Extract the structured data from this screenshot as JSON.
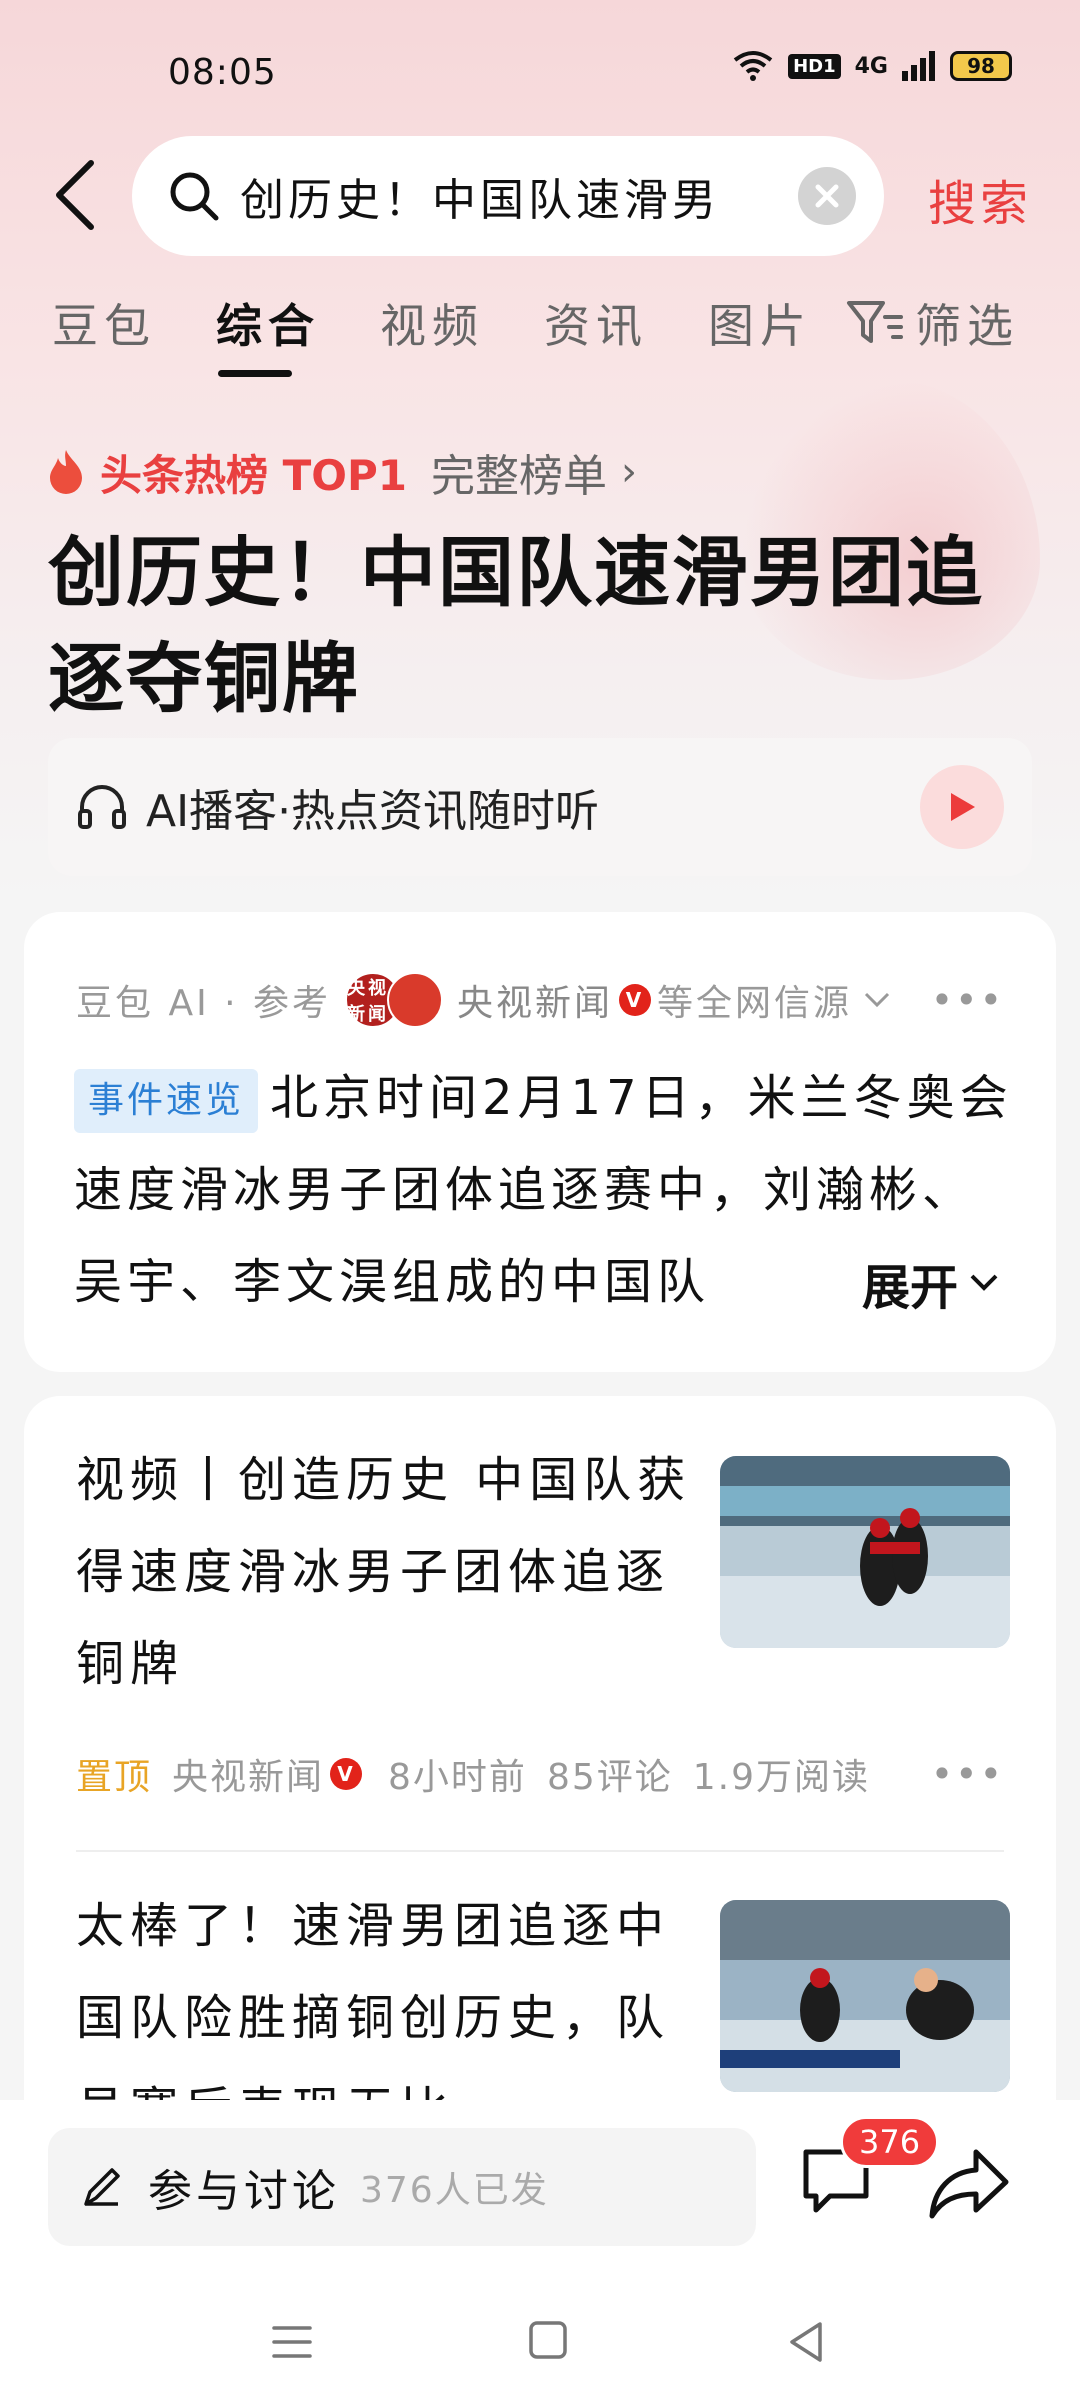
{
  "status_bar": {
    "time": "08:05",
    "hd": "HD1",
    "network": "4G",
    "battery": "98",
    "icons": [
      "wifi-icon",
      "hd-icon",
      "signal-icon",
      "battery-icon"
    ]
  },
  "search": {
    "query": "创历史！中国队速滑男",
    "action_label": "搜索"
  },
  "tabs": [
    {
      "label": "豆包"
    },
    {
      "label": "综合"
    },
    {
      "label": "视频"
    },
    {
      "label": "资讯"
    },
    {
      "label": "图片"
    }
  ],
  "filter_label": "筛选",
  "hot": {
    "label": "头条热榜 TOP1",
    "full_list": "完整榜单"
  },
  "headline": "创历史！中国队速滑男团追逐夺铜牌",
  "podcast": {
    "label": "AI播客·热点资讯随时听"
  },
  "summary_card": {
    "source_prefix": "豆包 AI · 参考",
    "avatar1": "央视新闻",
    "source_name": "央视新闻",
    "verified": "V",
    "source_suffix": "等全网信源",
    "tag": "事件速览",
    "text": "北京时间2月17日，米兰冬奥会速度滑冰男子团体追逐赛中，刘瀚彬、吴宇、李文淏组成的中国队",
    "expand_label": "展开"
  },
  "news": [
    {
      "title": "视频丨创造历史 中国队获得速度滑冰男子团体追逐铜牌",
      "pin": "置顶",
      "source": "央视新闻",
      "verified": "V",
      "time": "8小时前",
      "comments": "85评论",
      "reads": "1.9万阅读"
    },
    {
      "title": "太棒了！速滑男团追逐中国队险胜摘铜创历史，队员赛后表现无比……"
    }
  ],
  "bottom": {
    "discuss_label": "参与讨论",
    "discuss_count": "376人已发",
    "comment_badge": "376"
  },
  "colors": {
    "accent": "#e94040",
    "tag_bg": "#e0eefb",
    "tag_fg": "#2b7fd4",
    "pin": "#e8a425"
  }
}
